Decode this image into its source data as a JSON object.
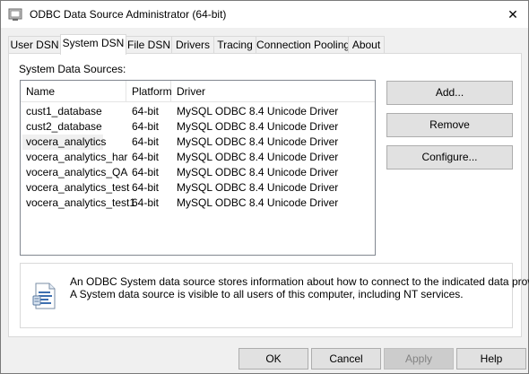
{
  "window": {
    "title": "ODBC Data Source Administrator (64-bit)",
    "close_glyph": "✕"
  },
  "tabs": [
    {
      "label": "User DSN"
    },
    {
      "label": "System DSN"
    },
    {
      "label": "File DSN"
    },
    {
      "label": "Drivers"
    },
    {
      "label": "Tracing"
    },
    {
      "label": "Connection Pooling"
    },
    {
      "label": "About"
    }
  ],
  "active_tab": "System DSN",
  "system_dsn": {
    "caption": "System Data Sources:",
    "columns": {
      "name": "Name",
      "platform": "Platform",
      "driver": "Driver"
    },
    "rows": [
      {
        "name": "cust1_database",
        "platform": "64-bit",
        "driver": "MySQL ODBC 8.4 Unicode Driver"
      },
      {
        "name": "cust2_database",
        "platform": "64-bit",
        "driver": "MySQL ODBC 8.4 Unicode Driver"
      },
      {
        "name": "vocera_analytics",
        "platform": "64-bit",
        "driver": "MySQL ODBC 8.4 Unicode Driver"
      },
      {
        "name": "vocera_analytics_har",
        "platform": "64-bit",
        "driver": "MySQL ODBC 8.4 Unicode Driver"
      },
      {
        "name": "vocera_analytics_QA",
        "platform": "64-bit",
        "driver": "MySQL ODBC 8.4 Unicode Driver"
      },
      {
        "name": "vocera_analytics_test",
        "platform": "64-bit",
        "driver": "MySQL ODBC 8.4 Unicode Driver"
      },
      {
        "name": "vocera_analytics_test1",
        "platform": "64-bit",
        "driver": "MySQL ODBC 8.4 Unicode Driver"
      }
    ],
    "selected_row": "vocera_analytics",
    "buttons": {
      "add": "Add...",
      "remove": "Remove",
      "configure": "Configure..."
    },
    "info": {
      "icon": "data-source-document-icon",
      "line1": "An ODBC System data source stores information about how to connect to the indicated data provider.",
      "line2": "A System data source is visible to all users of this computer, including NT services."
    }
  },
  "footer": {
    "ok": "OK",
    "cancel": "Cancel",
    "apply": "Apply",
    "help": "Help"
  }
}
